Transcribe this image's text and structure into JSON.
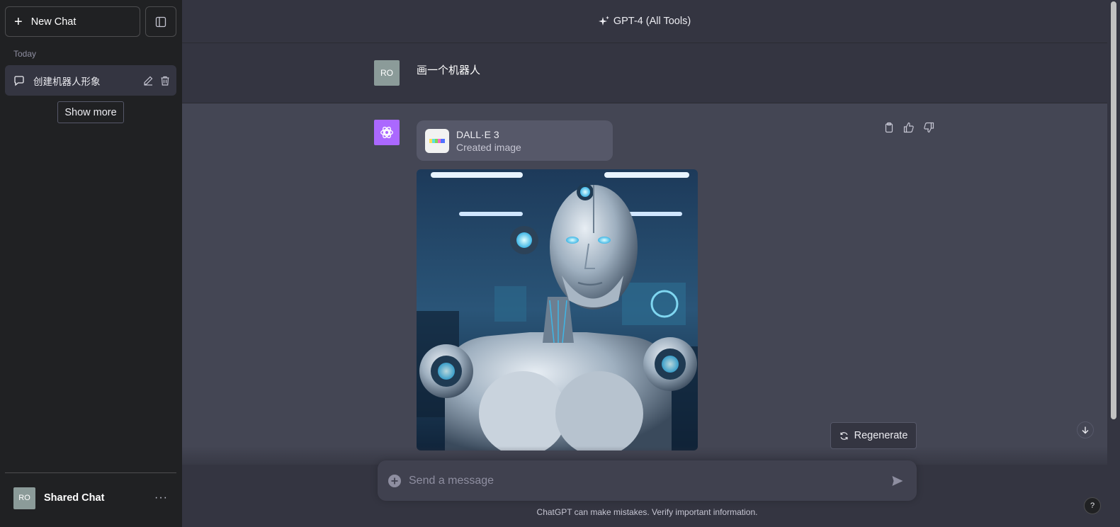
{
  "sidebar": {
    "new_chat_label": "New Chat",
    "section_label": "Today",
    "chats": [
      {
        "title": "创建机器人形象"
      }
    ],
    "show_more_label": "Show more",
    "user": {
      "initials": "RO",
      "name": "Shared Chat"
    }
  },
  "header": {
    "title": "GPT-4 (All Tools)"
  },
  "conversation": {
    "user_message": {
      "avatar_initials": "RO",
      "text": "画一个机器人"
    },
    "assistant_message": {
      "tool": {
        "name": "DALL·E 3",
        "status": "Created image"
      },
      "image_alt": "Generated image of a silver humanoid robot in a high-tech lab"
    }
  },
  "composer": {
    "regenerate_label": "Regenerate",
    "placeholder": "Send a message",
    "disclaimer": "ChatGPT can make mistakes. Verify important information.",
    "help_label": "?"
  },
  "colors": {
    "sidebar_bg": "#202123",
    "main_bg": "#343541",
    "assistant_bg": "#444654",
    "gpt_avatar": "#ab68ff",
    "user_avatar": "#8b9b99"
  }
}
